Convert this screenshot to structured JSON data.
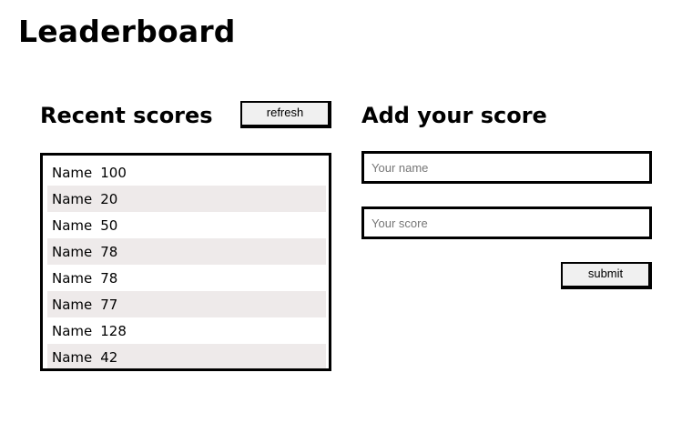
{
  "page": {
    "title": "Leaderboard"
  },
  "recent": {
    "title": "Recent scores",
    "refresh_label": "refresh",
    "scores": [
      {
        "name": "Name",
        "score": "100"
      },
      {
        "name": "Name",
        "score": "20"
      },
      {
        "name": "Name",
        "score": "50"
      },
      {
        "name": "Name",
        "score": "78"
      },
      {
        "name": "Name",
        "score": "78"
      },
      {
        "name": "Name",
        "score": "77"
      },
      {
        "name": "Name",
        "score": "128"
      },
      {
        "name": "Name",
        "score": "42"
      }
    ]
  },
  "add": {
    "title": "Add your score",
    "name_placeholder": "Your name",
    "score_placeholder": "Your score",
    "submit_label": "submit"
  }
}
